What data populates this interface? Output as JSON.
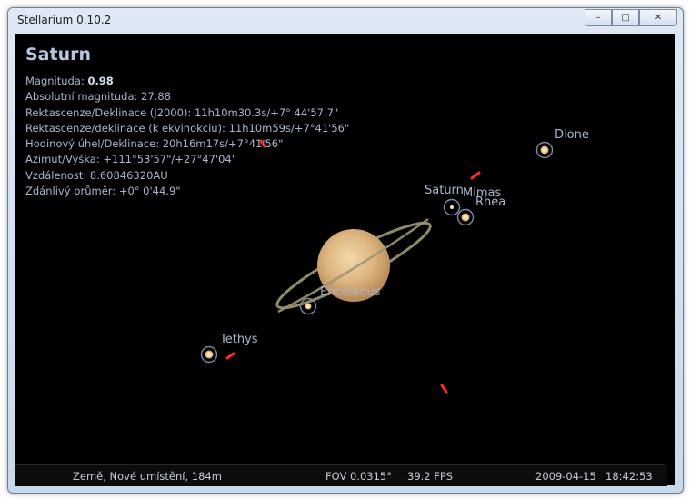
{
  "window": {
    "title": "Stellarium 0.10.2",
    "buttons": {
      "minimize": "–",
      "maximize": "□",
      "close": "✕"
    }
  },
  "info": {
    "object_name": "Saturn",
    "magnitude_label": "Magnituda: ",
    "magnitude_value": "0.98",
    "lines": [
      "Absolutní magnituda: 27.88",
      "Rektascenze/Deklinace (J2000): 11h10m30.3s/+7° 44'57.7\"",
      "Rektascenze/deklinace (k ekvinokciu): 11h10m59s/+7°41'56\"",
      "Hodinový úhel/Deklinace: 20h16m17s/+7°41'56\"",
      "Azimut/Výška: +111°53'57\"/+27°47'04\"",
      "Vzdálenost: 8.60846320AU",
      "Zdánlivý průměr: +0° 0'44.9\""
    ]
  },
  "sky_labels": {
    "dione": "Dione",
    "saturn": "Saturn",
    "mimas": "Mimas",
    "rhea": "Rhea",
    "enceladus": "Enceladus",
    "tethys": "Tethys"
  },
  "status": {
    "location": "Země, Nové umístění, 184m",
    "fov": "FOV 0.0315°",
    "fps": "39.2 FPS",
    "date": "2009-04-15",
    "time": "18:42:53"
  },
  "colors": {
    "sky": "#000000",
    "label": "#a9b7cf",
    "planet": "#e7c28e",
    "marker": "#ff2a2a"
  }
}
